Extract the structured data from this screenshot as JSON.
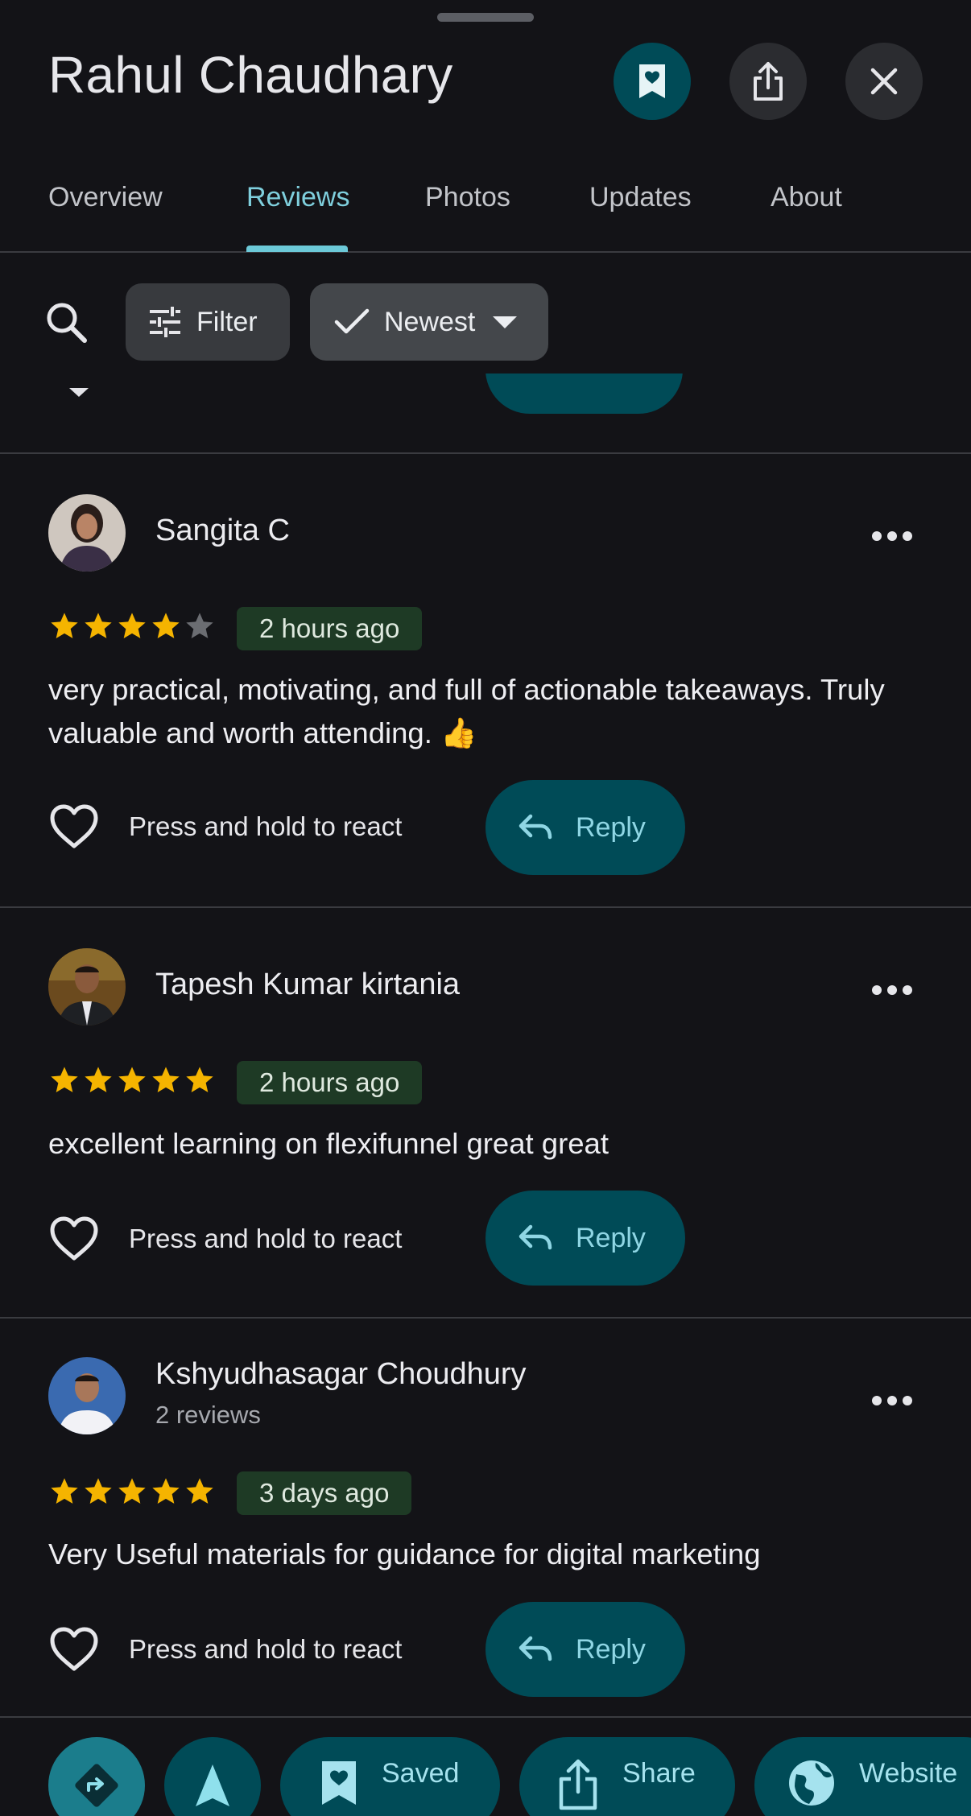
{
  "header": {
    "title": "Rahul Chaudhary",
    "save_icon": "bookmark-heart-icon",
    "share_icon": "share-icon",
    "close_icon": "close-icon"
  },
  "tabs": [
    {
      "label": "Overview",
      "active": false
    },
    {
      "label": "Reviews",
      "active": true
    },
    {
      "label": "Photos",
      "active": false
    },
    {
      "label": "Updates",
      "active": false
    },
    {
      "label": "About",
      "active": false
    }
  ],
  "toolbar": {
    "search_icon": "search-icon",
    "filter_label": "Filter",
    "sort_label": "Newest"
  },
  "reviews": [
    {
      "name": "Sangita C",
      "subtitle": "",
      "rating": 4,
      "time": "2 hours ago",
      "text": "very practical, motivating, and full of actionable takeaways. Truly valuable and worth attending. 👍",
      "react_label": "Press and hold to react",
      "reply_label": "Reply"
    },
    {
      "name": "Tapesh Kumar kirtania",
      "subtitle": "",
      "rating": 5,
      "time": "2 hours ago",
      "text": "excellent learning on flexifunnel great great",
      "react_label": "Press and hold to react",
      "reply_label": "Reply"
    },
    {
      "name": "Kshyudhasagar Choudhury",
      "subtitle": "2 reviews",
      "rating": 5,
      "time": "3 days ago",
      "text": "Very Useful materials for guidance for digital marketing",
      "react_label": "Press and hold to react",
      "reply_label": "Reply"
    }
  ],
  "bottom_actions": {
    "saved_label": "Saved",
    "share_label": "Share",
    "website_label": "Website"
  },
  "colors": {
    "background": "#131317",
    "accent_teal": "#004b57",
    "tab_active": "#7fcfdd",
    "star": "#f5b400",
    "badge_bg": "#1e3a25"
  }
}
